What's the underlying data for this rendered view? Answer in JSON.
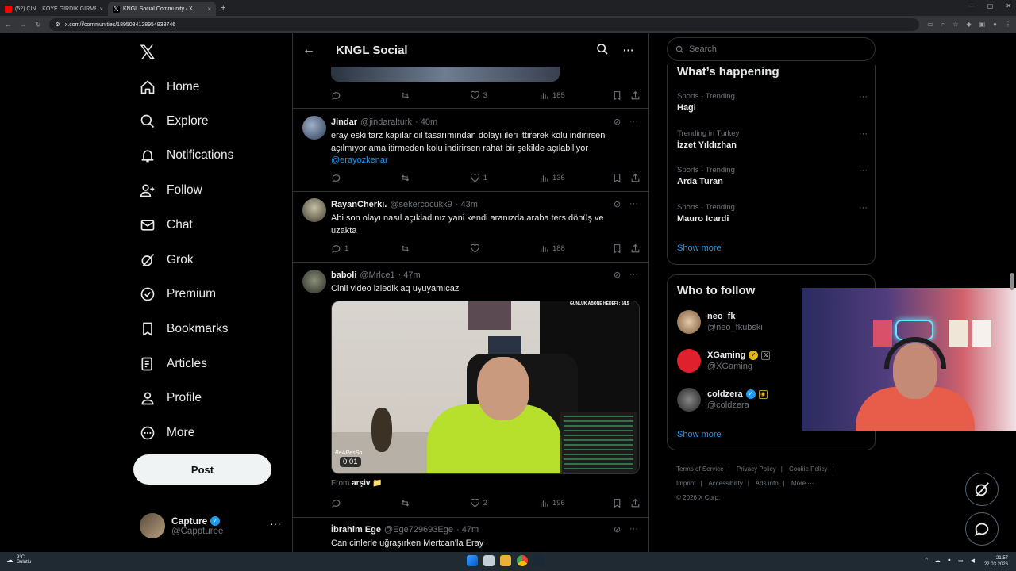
{
  "browser": {
    "tabs": [
      {
        "title": "(52) ÇİNLİ KÖYE GİRDİK GİRME",
        "close": "×"
      },
      {
        "title": "KNGL Social Community / X",
        "close": "×"
      }
    ],
    "new_tab": "+",
    "url": "x.com/i/communities/1895084128954933746"
  },
  "nav": {
    "logo": "𝕏",
    "items": [
      {
        "label": "Home",
        "icon": "home-icon"
      },
      {
        "label": "Explore",
        "icon": "search-icon"
      },
      {
        "label": "Notifications",
        "icon": "bell-icon"
      },
      {
        "label": "Follow",
        "icon": "follow-icon"
      },
      {
        "label": "Chat",
        "icon": "mail-icon"
      },
      {
        "label": "Grok",
        "icon": "grok-icon"
      },
      {
        "label": "Premium",
        "icon": "premium-icon"
      },
      {
        "label": "Bookmarks",
        "icon": "bookmark-icon"
      },
      {
        "label": "Articles",
        "icon": "articles-icon"
      },
      {
        "label": "Profile",
        "icon": "profile-icon"
      },
      {
        "label": "More",
        "icon": "more-circle-icon"
      }
    ],
    "post_label": "Post",
    "account": {
      "name": "Capture",
      "handle": "@Cappturee",
      "more": "···"
    }
  },
  "community": {
    "back": "←",
    "title": "KNGL Social",
    "more": "···"
  },
  "tweets": [
    {
      "stats": {
        "replies": "",
        "reposts": "",
        "likes": "3",
        "views": "185"
      }
    },
    {
      "name": "Jindar",
      "handle": "@jindaralturk",
      "time": "· 40m",
      "text": "eray eski tarz kapılar dil tasarımından dolayı ileri ittirerek kolu indirirsen açılmıyor ama itirmeden kolu indirirsen rahat bir şekilde açılabiliyor",
      "mention": "@erayozkenar",
      "stats": {
        "replies": "",
        "reposts": "",
        "likes": "1",
        "views": "136"
      }
    },
    {
      "name": "RayanCherki.",
      "handle": "@sekercocukk9",
      "time": "· 43m",
      "text": "Abi son olayı nasıl açıkladınız yani kendi aranızda araba ters dönüş ve uzakta",
      "stats": {
        "replies": "1",
        "reposts": "",
        "likes": "",
        "views": "188"
      }
    },
    {
      "name": "baboli",
      "handle": "@Mrlce1",
      "time": "· 47m",
      "text": "Cinli video izledik aq uyuyamıcaz",
      "video": {
        "duration": "0:01",
        "banner": "GUNLUK ABONE HEDEFI : 5/15",
        "watermark": "BeAResSo"
      },
      "from_label": "From",
      "from_name": "arşiv 📁",
      "stats": {
        "replies": "",
        "reposts": "",
        "likes": "2",
        "views": "196"
      }
    },
    {
      "name": "İbrahim Ege",
      "handle": "@Ege729693Ege",
      "time": "· 47m",
      "text": "Can cinlerle uğraşırken Mertcan'la Eray"
    }
  ],
  "sidebar": {
    "search_placeholder": "Search",
    "happening_title": "What’s happening",
    "trends": [
      {
        "meta": "Sports · Trending",
        "name": "Hagi"
      },
      {
        "meta": "Trending in Turkey",
        "name": "İzzet Yıldızhan"
      },
      {
        "meta": "Sports · Trending",
        "name": "Arda Turan"
      },
      {
        "meta": "Sports · Trending",
        "name": "Mauro Icardi"
      }
    ],
    "trend_more": "···",
    "show_more": "Show more",
    "who_title": "Who to follow",
    "follow": [
      {
        "name": "neo_fk",
        "handle": "@neo_fkubski"
      },
      {
        "name": "XGaming",
        "handle": "@XGaming"
      },
      {
        "name": "coldzera",
        "handle": "@coldzera"
      }
    ],
    "who_show_more": "Show more",
    "footer": [
      "Terms of Service",
      "|",
      "Privacy Policy",
      "|",
      "Cookie Policy",
      "|",
      "Imprint",
      "|",
      "Accessibility",
      "|",
      "Ads info",
      "|",
      "More ···",
      "© 2026 X Corp."
    ]
  },
  "taskbar": {
    "weather_temp": "9°C",
    "weather_desc": "Bulutlu",
    "time": "21:57",
    "date": "22.03.2026"
  },
  "colors": {
    "accent": "#1d9bf0",
    "background": "#000000",
    "border": "#2f3336",
    "muted": "#71767b"
  }
}
